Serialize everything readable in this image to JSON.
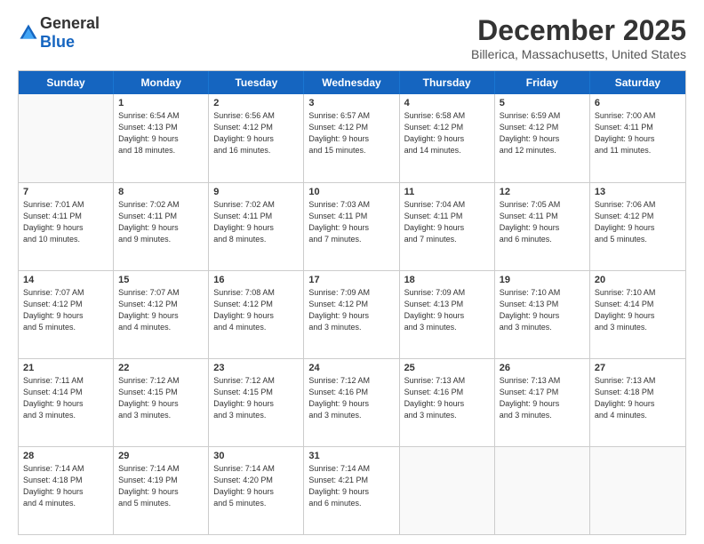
{
  "header": {
    "logo": {
      "general": "General",
      "blue": "Blue"
    },
    "title": "December 2025",
    "location": "Billerica, Massachusetts, United States"
  },
  "weekdays": [
    "Sunday",
    "Monday",
    "Tuesday",
    "Wednesday",
    "Thursday",
    "Friday",
    "Saturday"
  ],
  "weeks": [
    [
      {
        "day": "",
        "info": ""
      },
      {
        "day": "1",
        "info": "Sunrise: 6:54 AM\nSunset: 4:13 PM\nDaylight: 9 hours\nand 18 minutes."
      },
      {
        "day": "2",
        "info": "Sunrise: 6:56 AM\nSunset: 4:12 PM\nDaylight: 9 hours\nand 16 minutes."
      },
      {
        "day": "3",
        "info": "Sunrise: 6:57 AM\nSunset: 4:12 PM\nDaylight: 9 hours\nand 15 minutes."
      },
      {
        "day": "4",
        "info": "Sunrise: 6:58 AM\nSunset: 4:12 PM\nDaylight: 9 hours\nand 14 minutes."
      },
      {
        "day": "5",
        "info": "Sunrise: 6:59 AM\nSunset: 4:12 PM\nDaylight: 9 hours\nand 12 minutes."
      },
      {
        "day": "6",
        "info": "Sunrise: 7:00 AM\nSunset: 4:11 PM\nDaylight: 9 hours\nand 11 minutes."
      }
    ],
    [
      {
        "day": "7",
        "info": "Sunrise: 7:01 AM\nSunset: 4:11 PM\nDaylight: 9 hours\nand 10 minutes."
      },
      {
        "day": "8",
        "info": "Sunrise: 7:02 AM\nSunset: 4:11 PM\nDaylight: 9 hours\nand 9 minutes."
      },
      {
        "day": "9",
        "info": "Sunrise: 7:02 AM\nSunset: 4:11 PM\nDaylight: 9 hours\nand 8 minutes."
      },
      {
        "day": "10",
        "info": "Sunrise: 7:03 AM\nSunset: 4:11 PM\nDaylight: 9 hours\nand 7 minutes."
      },
      {
        "day": "11",
        "info": "Sunrise: 7:04 AM\nSunset: 4:11 PM\nDaylight: 9 hours\nand 7 minutes."
      },
      {
        "day": "12",
        "info": "Sunrise: 7:05 AM\nSunset: 4:11 PM\nDaylight: 9 hours\nand 6 minutes."
      },
      {
        "day": "13",
        "info": "Sunrise: 7:06 AM\nSunset: 4:12 PM\nDaylight: 9 hours\nand 5 minutes."
      }
    ],
    [
      {
        "day": "14",
        "info": "Sunrise: 7:07 AM\nSunset: 4:12 PM\nDaylight: 9 hours\nand 5 minutes."
      },
      {
        "day": "15",
        "info": "Sunrise: 7:07 AM\nSunset: 4:12 PM\nDaylight: 9 hours\nand 4 minutes."
      },
      {
        "day": "16",
        "info": "Sunrise: 7:08 AM\nSunset: 4:12 PM\nDaylight: 9 hours\nand 4 minutes."
      },
      {
        "day": "17",
        "info": "Sunrise: 7:09 AM\nSunset: 4:12 PM\nDaylight: 9 hours\nand 3 minutes."
      },
      {
        "day": "18",
        "info": "Sunrise: 7:09 AM\nSunset: 4:13 PM\nDaylight: 9 hours\nand 3 minutes."
      },
      {
        "day": "19",
        "info": "Sunrise: 7:10 AM\nSunset: 4:13 PM\nDaylight: 9 hours\nand 3 minutes."
      },
      {
        "day": "20",
        "info": "Sunrise: 7:10 AM\nSunset: 4:14 PM\nDaylight: 9 hours\nand 3 minutes."
      }
    ],
    [
      {
        "day": "21",
        "info": "Sunrise: 7:11 AM\nSunset: 4:14 PM\nDaylight: 9 hours\nand 3 minutes."
      },
      {
        "day": "22",
        "info": "Sunrise: 7:12 AM\nSunset: 4:15 PM\nDaylight: 9 hours\nand 3 minutes."
      },
      {
        "day": "23",
        "info": "Sunrise: 7:12 AM\nSunset: 4:15 PM\nDaylight: 9 hours\nand 3 minutes."
      },
      {
        "day": "24",
        "info": "Sunrise: 7:12 AM\nSunset: 4:16 PM\nDaylight: 9 hours\nand 3 minutes."
      },
      {
        "day": "25",
        "info": "Sunrise: 7:13 AM\nSunset: 4:16 PM\nDaylight: 9 hours\nand 3 minutes."
      },
      {
        "day": "26",
        "info": "Sunrise: 7:13 AM\nSunset: 4:17 PM\nDaylight: 9 hours\nand 3 minutes."
      },
      {
        "day": "27",
        "info": "Sunrise: 7:13 AM\nSunset: 4:18 PM\nDaylight: 9 hours\nand 4 minutes."
      }
    ],
    [
      {
        "day": "28",
        "info": "Sunrise: 7:14 AM\nSunset: 4:18 PM\nDaylight: 9 hours\nand 4 minutes."
      },
      {
        "day": "29",
        "info": "Sunrise: 7:14 AM\nSunset: 4:19 PM\nDaylight: 9 hours\nand 5 minutes."
      },
      {
        "day": "30",
        "info": "Sunrise: 7:14 AM\nSunset: 4:20 PM\nDaylight: 9 hours\nand 5 minutes."
      },
      {
        "day": "31",
        "info": "Sunrise: 7:14 AM\nSunset: 4:21 PM\nDaylight: 9 hours\nand 6 minutes."
      },
      {
        "day": "",
        "info": ""
      },
      {
        "day": "",
        "info": ""
      },
      {
        "day": "",
        "info": ""
      }
    ]
  ]
}
